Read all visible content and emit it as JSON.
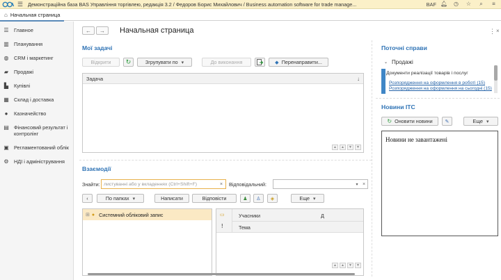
{
  "app": {
    "title": "Демонстраційна база BAS Управління торгівлею, редакція 3.2 / Федоров Борис Михайлович / Business automation software for trade manage...",
    "brand": "BAF"
  },
  "tabs": {
    "home": "Начальная страница"
  },
  "sidebar": {
    "items": [
      {
        "icon": "menu-lines-icon",
        "label": "Главное"
      },
      {
        "icon": "chart-icon",
        "label": "Планування"
      },
      {
        "icon": "crm-icon",
        "label": "CRM і маркетинг"
      },
      {
        "icon": "bag-icon",
        "label": "Продажі"
      },
      {
        "icon": "cart-icon",
        "label": "Купівлі"
      },
      {
        "icon": "warehouse-icon",
        "label": "Склад і доставка"
      },
      {
        "icon": "money-icon",
        "label": "Казначейство"
      },
      {
        "icon": "report-icon",
        "label": "Фінансовий результат і контролінг"
      },
      {
        "icon": "ledger-icon",
        "label": "Регламентований облік"
      },
      {
        "icon": "gear-icon",
        "label": "НДІ і адміністрування"
      }
    ]
  },
  "main": {
    "page_title": "Начальная страница"
  },
  "tasks": {
    "title": "Мої задачі",
    "open_btn": "Відкрити",
    "group_btn": "Згрупувати по",
    "done_btn": "До виконання",
    "redirect_btn": "Перенаправити...",
    "column": "Задача"
  },
  "interactions": {
    "title": "Взаємодії",
    "find_label": "Знайти:",
    "find_placeholder": "листуванні або у вкладеннях (Ctrl+Shift+F)",
    "responsible_label": "Відповідальний:",
    "folders_btn": "По папках",
    "write_btn": "Написати",
    "replies_btn": "Відповісти",
    "more_btn": "Еще",
    "tree_item": "Системний обліковий запис",
    "col_participants": "Учасники",
    "col_topic": "Тема",
    "col_d": "Д"
  },
  "current": {
    "title": "Поточні справи",
    "group": "Продажі",
    "doc": "Документи реалізації товарів і послуг",
    "link1": "Розпорядження на оформлення в роботі (15)",
    "link2": "Розпорядження на оформлення на сьогодні (15)"
  },
  "news": {
    "title": "Новини ІТС",
    "refresh_btn": "Оновити новини",
    "more_btn": "Еще",
    "empty_text": "Новини не завантажені"
  },
  "colors": {
    "accent": "#2f73b5",
    "titlebar": "#fbf0c8",
    "selected_row": "#fbe9c4"
  }
}
